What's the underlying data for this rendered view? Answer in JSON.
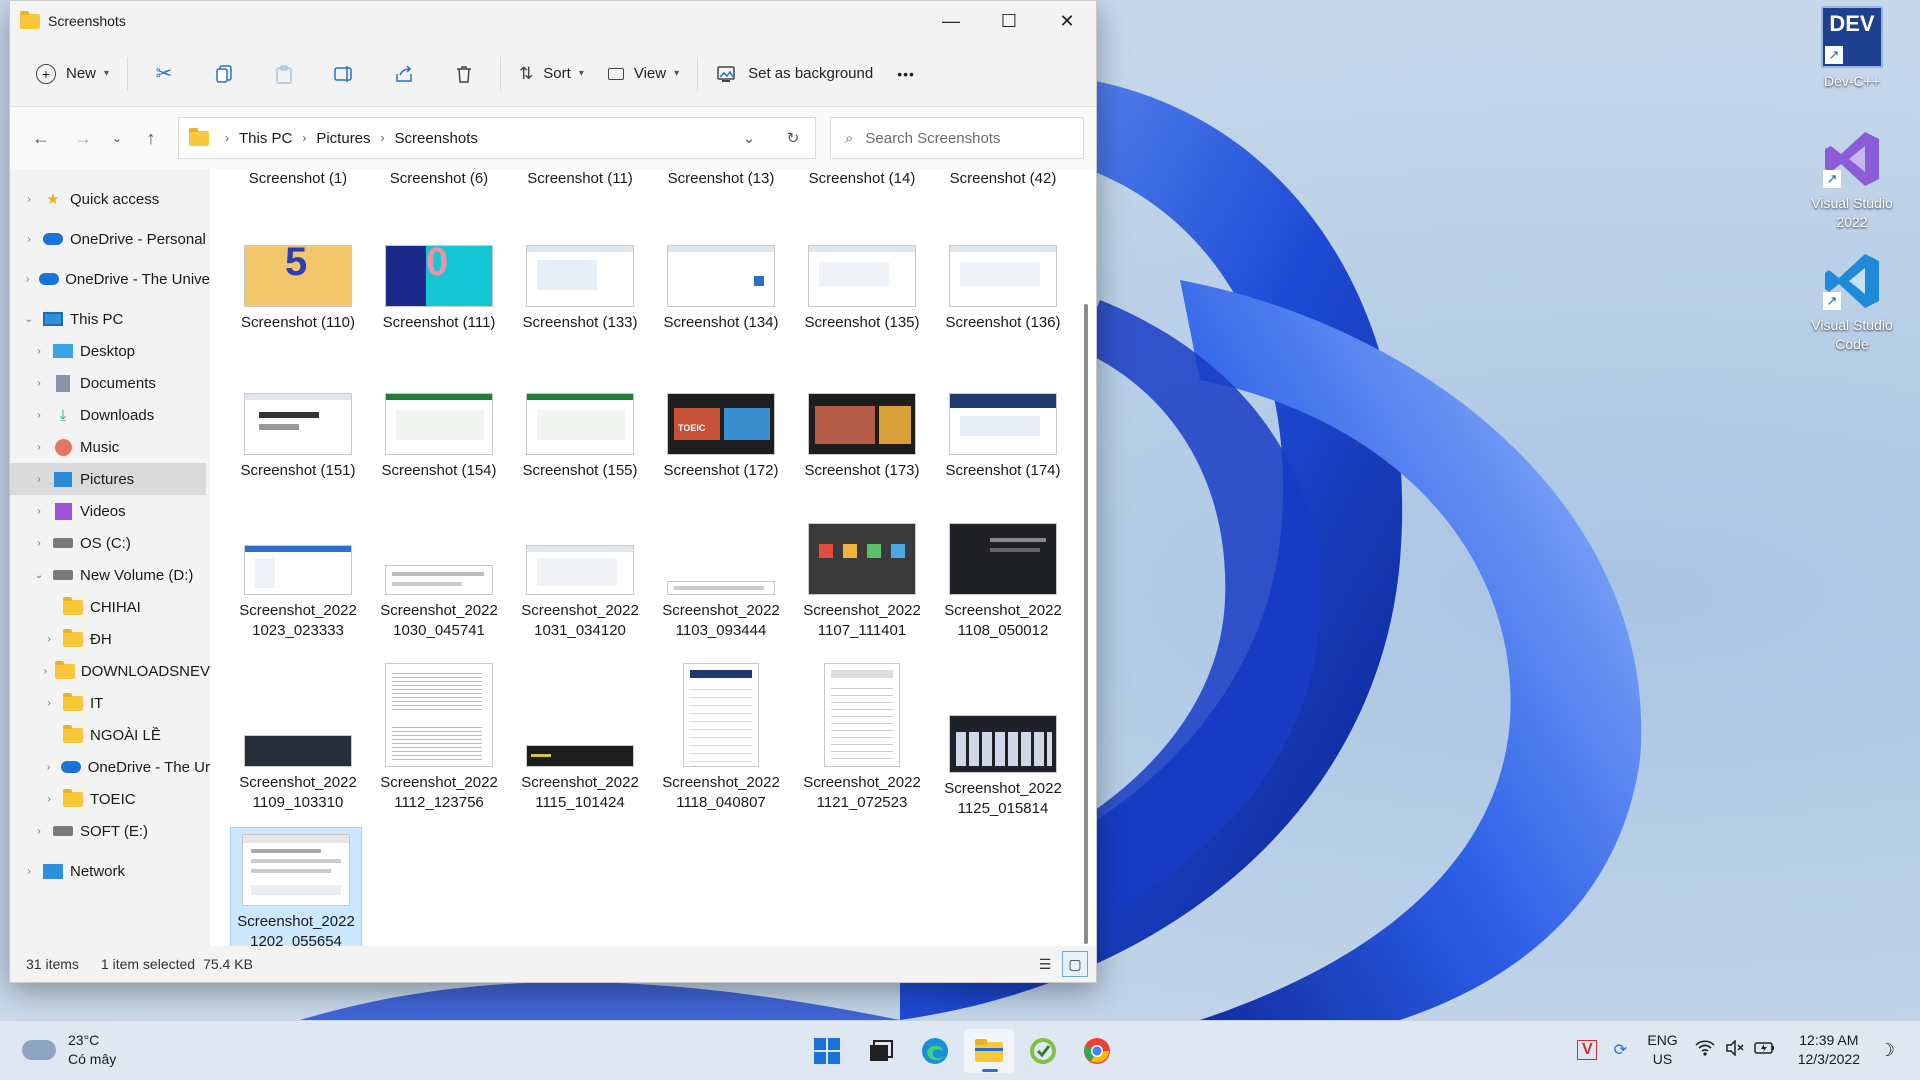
{
  "window": {
    "title": "Screenshots",
    "minimize_glyph": "—",
    "maximize_glyph": "☐",
    "close_glyph": "✕"
  },
  "commandbar": {
    "new_label": "New",
    "sort_label": "Sort",
    "view_label": "View",
    "set_background_label": "Set as background",
    "more_glyph": "•••"
  },
  "address": {
    "crumbs": [
      "This PC",
      "Pictures",
      "Screenshots"
    ],
    "search_placeholder": "Search Screenshots"
  },
  "nav": {
    "items": [
      {
        "label": "Quick access",
        "icon": "star-icon"
      },
      {
        "label": "OneDrive - Personal",
        "icon": "cloud-icon"
      },
      {
        "label": "OneDrive - The Unive",
        "icon": "cloud-icon"
      },
      {
        "label": "This PC",
        "icon": "pc-icon"
      },
      {
        "label": "Desktop",
        "icon": "desktop-icon"
      },
      {
        "label": "Documents",
        "icon": "documents-icon"
      },
      {
        "label": "Downloads",
        "icon": "download-icon"
      },
      {
        "label": "Music",
        "icon": "music-icon"
      },
      {
        "label": "Pictures",
        "icon": "pictures-icon"
      },
      {
        "label": "Videos",
        "icon": "videos-icon"
      },
      {
        "label": "OS (C:)",
        "icon": "drive-icon"
      },
      {
        "label": "New Volume (D:)",
        "icon": "drive-icon"
      },
      {
        "label": "CHIHAI",
        "icon": "folder-icon"
      },
      {
        "label": "ĐH",
        "icon": "folder-icon"
      },
      {
        "label": "DOWNLOADSNEV",
        "icon": "folder-icon"
      },
      {
        "label": "IT",
        "icon": "folder-icon"
      },
      {
        "label": "NGOÀI LỀ",
        "icon": "folder-icon"
      },
      {
        "label": "OneDrive - The Ur",
        "icon": "cloud-icon"
      },
      {
        "label": "TOEIC",
        "icon": "folder-icon"
      },
      {
        "label": "SOFT (E:)",
        "icon": "drive-icon"
      },
      {
        "label": "Network",
        "icon": "network-icon"
      }
    ]
  },
  "files": {
    "row0": [
      "Screenshot (1)",
      "Screenshot (6)",
      "Screenshot (11)",
      "Screenshot (13)",
      "Screenshot (14)",
      "Screenshot (42)"
    ],
    "row1": [
      "Screenshot (110)",
      "Screenshot (111)",
      "Screenshot (133)",
      "Screenshot (134)",
      "Screenshot (135)",
      "Screenshot (136)"
    ],
    "row2": [
      "Screenshot (151)",
      "Screenshot (154)",
      "Screenshot (155)",
      "Screenshot (172)",
      "Screenshot (173)",
      "Screenshot (174)"
    ],
    "row3": [
      [
        "Screenshot_2022",
        "1023_023333"
      ],
      [
        "Screenshot_2022",
        "1030_045741"
      ],
      [
        "Screenshot_2022",
        "1031_034120"
      ],
      [
        "Screenshot_2022",
        "1103_093444"
      ],
      [
        "Screenshot_2022",
        "1107_111401"
      ],
      [
        "Screenshot_2022",
        "1108_050012"
      ]
    ],
    "row4": [
      [
        "Screenshot_2022",
        "1109_103310"
      ],
      [
        "Screenshot_2022",
        "1112_123756"
      ],
      [
        "Screenshot_2022",
        "1115_101424"
      ],
      [
        "Screenshot_2022",
        "1118_040807"
      ],
      [
        "Screenshot_2022",
        "1121_072523"
      ],
      [
        "Screenshot_2022",
        "1125_015814"
      ]
    ],
    "row5": [
      [
        "Screenshot_2022",
        "1202_055654"
      ]
    ],
    "thumb_text": {
      "t110": "5",
      "t111": "0",
      "toeic": "TOEIC"
    }
  },
  "status": {
    "count": "31 items",
    "selection": "1 item selected",
    "size": "75.4 KB"
  },
  "desktop": {
    "icons": [
      {
        "label": "Dev-C++",
        "badge": "DEV"
      },
      {
        "label": "Visual Studio 2022"
      },
      {
        "label": "Visual Studio Code"
      }
    ],
    "shortcut_arrow": "↗"
  },
  "taskbar": {
    "weather_temp": "23°C",
    "weather_desc": "Có mây",
    "lang_line1": "ENG",
    "lang_line2": "US",
    "time": "12:39 AM",
    "date": "12/3/2022",
    "vietkey_glyph": "V"
  },
  "colors": {
    "accent": "#1a73d8",
    "selection_bg": "#cce8ff",
    "wallpaper_blue": "#1f4fd6"
  }
}
